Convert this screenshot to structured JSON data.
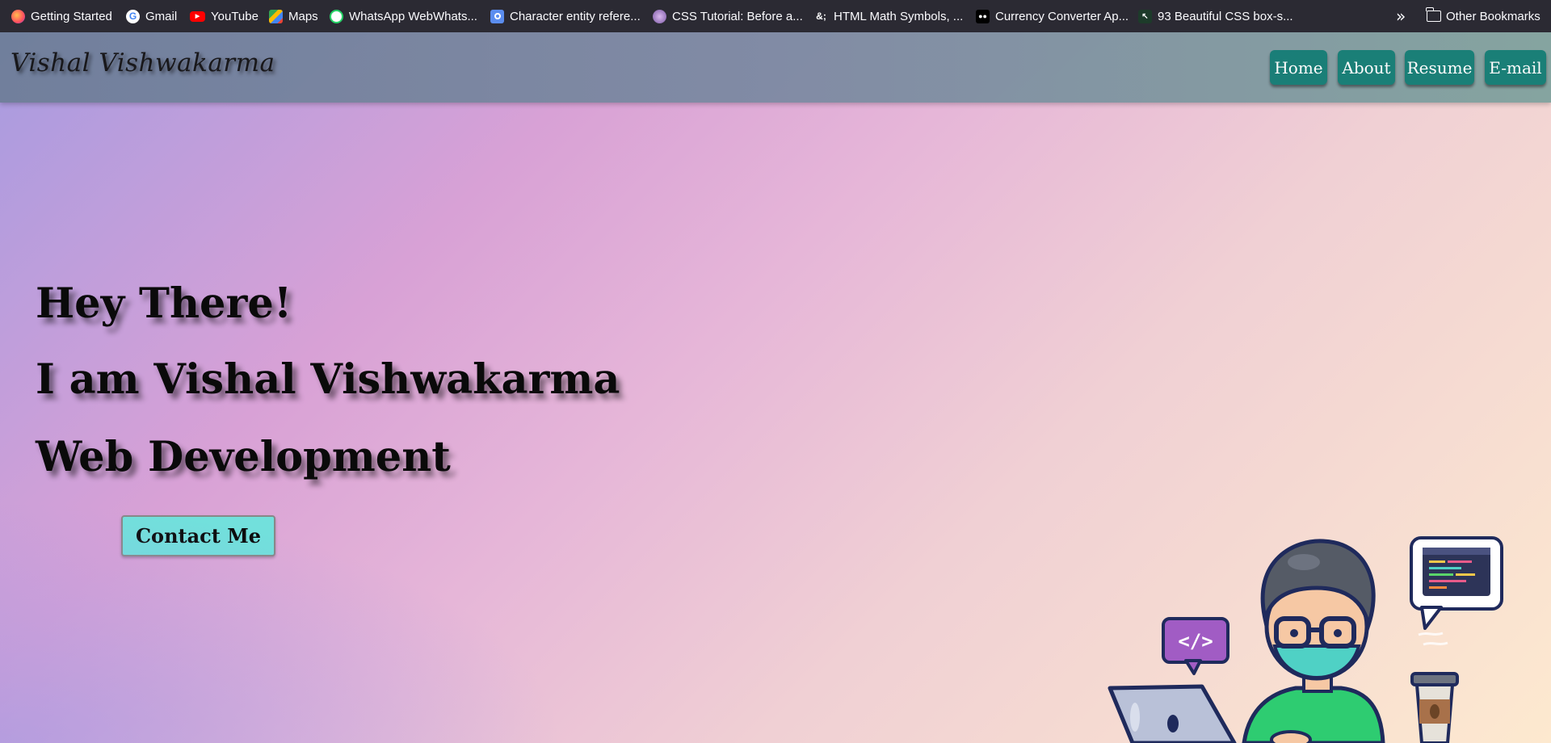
{
  "bookmarks": [
    {
      "label": "Getting Started",
      "icon": "firefox-icon",
      "color": "#ff7139"
    },
    {
      "label": "Gmail",
      "icon": "google-icon",
      "color": "#4285f4"
    },
    {
      "label": "YouTube",
      "icon": "youtube-icon",
      "color": "#ff0000"
    },
    {
      "label": "Maps",
      "icon": "maps-icon",
      "color": "#34a853"
    },
    {
      "label": "WhatsApp WebWhats...",
      "icon": "whatsapp-icon",
      "color": "#25d366"
    },
    {
      "label": "Character entity refere...",
      "icon": "entity-icon",
      "color": "#5b8def"
    },
    {
      "label": "CSS Tutorial: Before a...",
      "icon": "avatar-icon",
      "color": "#9a7ac9"
    },
    {
      "label": "HTML Math Symbols, ...",
      "icon": "ampersand-icon",
      "color": "#333333"
    },
    {
      "label": "Currency Converter Ap...",
      "icon": "medium-icon",
      "color": "#000000"
    },
    {
      "label": "93 Beautiful CSS box-s...",
      "icon": "cursor-icon",
      "color": "#1d3b2a"
    }
  ],
  "other_bookmarks": "Other Bookmarks",
  "brand": "Vishal Vishwakarma",
  "nav": [
    "Home",
    "About",
    "Resume",
    "E-mail"
  ],
  "hero": {
    "line1": "Hey There!",
    "line2": "I am Vishal Vishwakarma",
    "line3": "Web Development"
  },
  "contact_label": "Contact Me",
  "colors": {
    "nav_button": "#0f7b73",
    "contact_button": "#72e0dc"
  }
}
